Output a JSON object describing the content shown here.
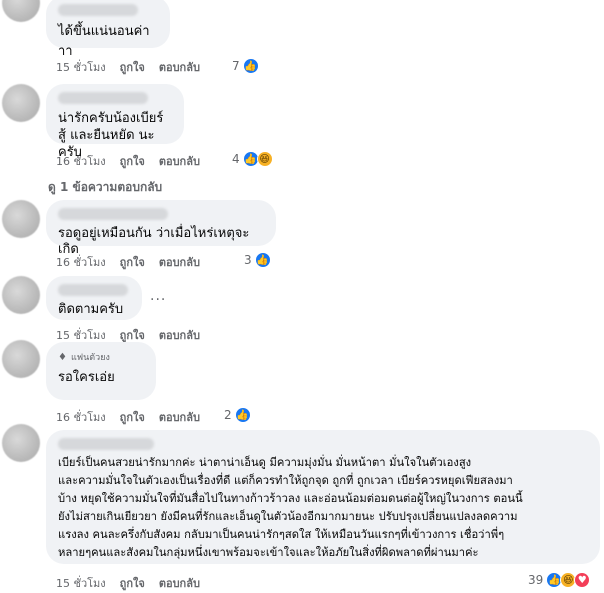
{
  "comments": [
    {
      "text": "ได้ขึ้นแน่นอนค่าาา",
      "time": "15 ชั่วโมง",
      "like_label": "ถูกใจ",
      "reply_label": "ตอบกลับ",
      "reaction_count": "7",
      "reactions": [
        "like-icon"
      ]
    },
    {
      "text": "น่ารักครับน้องเบียร์\nสู้ และยืนหยัด นะครับ",
      "time": "16 ชั่วโมง",
      "like_label": "ถูกใจ",
      "reply_label": "ตอบกลับ",
      "reaction_count": "4",
      "reactions": [
        "like-icon",
        "haha-icon"
      ]
    },
    {
      "text": "รอดูอยู่เหมือนกัน ว่าเมื่อไหร่เหตุจะเกิด",
      "time": "16 ชั่วโมง",
      "like_label": "ถูกใจ",
      "reply_label": "ตอบกลับ",
      "reaction_count": "3",
      "reactions": [
        "like-icon"
      ]
    },
    {
      "text": "ติดตามครับ",
      "time": "15 ชั่วโมง",
      "like_label": "ถูกใจ",
      "reply_label": "ตอบกลับ",
      "more": "..."
    },
    {
      "badge": "แฟนตัวยง",
      "text": "รอใครเอ่ย",
      "time": "16 ชั่วโมง",
      "like_label": "ถูกใจ",
      "reply_label": "ตอบกลับ",
      "reaction_count": "2",
      "reactions": [
        "like-icon"
      ]
    },
    {
      "text": "เบียร์เป็นคนสวยน่ารักมากค่ะ น่าตาน่าเอ็นดู มีความมุ่งมั่น มั่นหน้าตา มั่นใจในตัวเองสูง\nและความมั่นใจในตัวเองเป็นเรื่องที่ดี แต่ก็ควรทำให้ถูกจุด ถูกที่ ถูกเวลา เบียร์ควรหยุดเฟียสลงมา\nบ้าง หยุดใช้ความมั่นใจที่มันสื่อไปในทางก้าวร้าวลง และอ่อนน้อมต่อมดนต่อผู้ใหญ่ในวงการ ตอนนี้\nยังไม่สายเกินเยียวยา ยังมีคนที่รักและเอ็นดูในตัวน้องอีกมากมายนะ ปรับปรุงเปลี่ยนแปลงลดความ\nแรงลง คนละครึ่งกับสังคม กลับมาเป็นคนน่ารักๆสดใส ให้เหมือนวันแรกๆที่เข้าวงการ เชื่อว่าพี่ๆ\nหลายๆคนและสังคมในกลุ่มหนึ่งเขาพร้อมจะเข้าใจและให้อภัยในสิ่งที่ผิดพลาดที่ผ่านมาค่ะ",
      "time": "15 ชั่วโมง",
      "like_label": "ถูกใจ",
      "reply_label": "ตอบกลับ",
      "reaction_count": "39",
      "reactions": [
        "like-icon",
        "haha-icon",
        "heart-icon"
      ]
    }
  ],
  "view_replies_label": "ดู 1 ข้อความตอบกลับ",
  "colors": {
    "bubble": "#f0f2f5",
    "like": "#1877f2",
    "muted": "#65676b"
  }
}
